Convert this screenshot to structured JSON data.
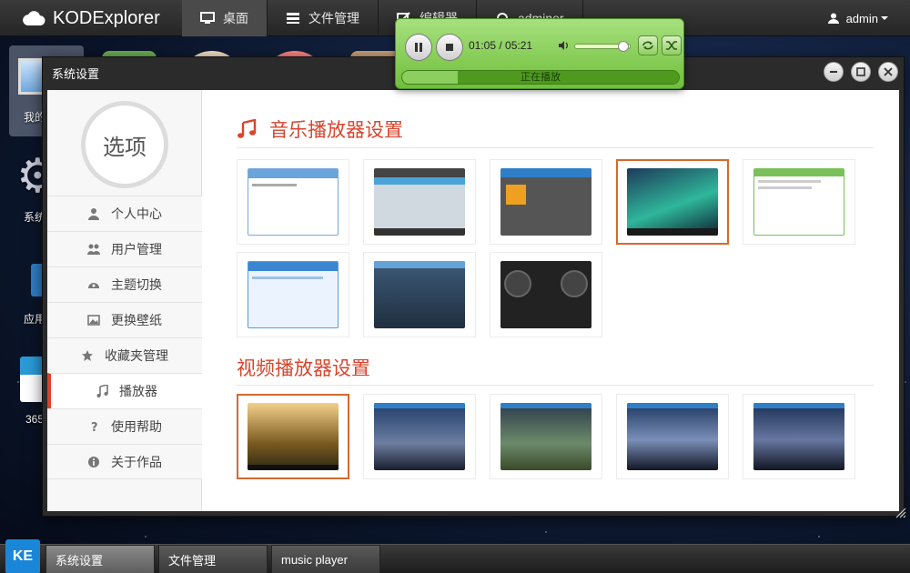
{
  "topbar": {
    "logo_text": "KODExplorer",
    "nav": [
      {
        "label": "桌面",
        "icon": "desktop-icon",
        "active": true
      },
      {
        "label": "文件管理",
        "icon": "folder-list-icon"
      },
      {
        "label": "编辑器",
        "icon": "edit-icon"
      },
      {
        "label": "adminer",
        "icon": "plugin-icon"
      }
    ],
    "user": "admin"
  },
  "desktop_icons": [
    {
      "label": "我的",
      "icon": "computer-icon"
    },
    {
      "label": "系统",
      "icon": "gear-icon"
    },
    {
      "label": "应用",
      "icon": "app-store-icon"
    },
    {
      "label": "365",
      "icon": "book-icon"
    }
  ],
  "player": {
    "time": "01:05 / 05:21",
    "status": "正在播放",
    "volume": 0.85,
    "progress": 0.2
  },
  "window": {
    "title": "系统设置",
    "options_label": "选项",
    "menu": [
      {
        "label": "个人中心",
        "icon": "user-icon"
      },
      {
        "label": "用户管理",
        "icon": "users-icon"
      },
      {
        "label": "主题切换",
        "icon": "palette-icon"
      },
      {
        "label": "更换壁纸",
        "icon": "picture-icon"
      },
      {
        "label": "收藏夹管理",
        "icon": "star-icon"
      },
      {
        "label": "播放器",
        "icon": "music-note-icon",
        "active": true
      },
      {
        "label": "使用帮助",
        "icon": "question-icon"
      },
      {
        "label": "关于作品",
        "icon": "info-icon"
      }
    ],
    "music_title": "音乐播放器设置",
    "video_title": "视频播放器设置",
    "selected_music_skin": 4,
    "selected_video_skin": 1
  },
  "taskbar": {
    "start_label": "KE",
    "tasks": [
      {
        "label": "系统设置",
        "active": true
      },
      {
        "label": "文件管理"
      },
      {
        "label": "music player"
      }
    ]
  },
  "colors": {
    "accent": "#d8452d",
    "selected_border": "#d4692f",
    "player_green": "#8bd05a"
  }
}
